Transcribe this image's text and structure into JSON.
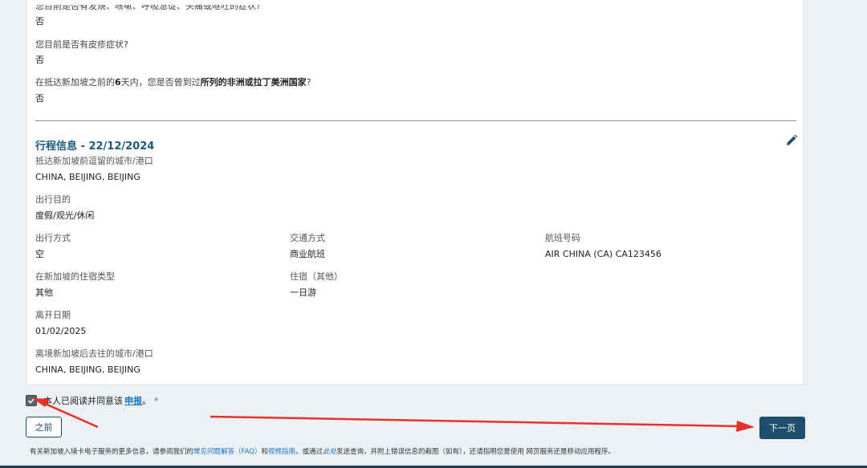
{
  "health": {
    "q1": "您目前是否有发烧、咳嗽、呼吸急促、头痛或呕吐的症状?",
    "a1": "否",
    "q2": "您目前是否有皮疹症状?",
    "a2": "否",
    "q3_pre": "在抵达新加坡之前的",
    "q3_days": "6",
    "q3_mid": "天内，您是否曾到过",
    "q3_bold": "所列的非洲或拉丁美洲国家",
    "q3_post": "?",
    "a3": "否"
  },
  "trip": {
    "title": "行程信息 - 22/12/2024",
    "last_city_label": "抵达新加坡前逗留的城市/港口",
    "last_city_value": "CHINA, BEIJING, BEIJING",
    "purpose_label": "出行目的",
    "purpose_value": "度假/观光/休闲",
    "mode_label": "出行方式",
    "mode_value": "空",
    "transport_label": "交通方式",
    "transport_value": "商业航班",
    "flight_label": "航班号码",
    "flight_value": "AIR CHINA (CA) CA123456",
    "accom_type_label": "在新加坡的住宿类型",
    "accom_type_value": "其他",
    "accom_other_label": "住宿（其他）",
    "accom_other_value": "一日游",
    "depart_date_label": "离开日期",
    "depart_date_value": "01/02/2025",
    "next_city_label": "离境新加坡后去往的城市/港口",
    "next_city_value": "CHINA, BEIJING, BEIJING"
  },
  "agree": {
    "text": "本人已阅读并同意该",
    "link": "申报",
    "period": "。",
    "asterisk": "*"
  },
  "buttons": {
    "prev": "之前",
    "next": "下一页"
  },
  "footer": {
    "t1": "有关新加坡入境卡电子服务的更多信息，请参阅我们的",
    "faq": "常见问题解答（FAQ）",
    "t2": "和",
    "guide": "视频指南",
    "t3": "。或通过",
    "here": "此处",
    "t4": "发送查询，并附上错误信息的截图（如有），还请指明您是使用 网页服务还是移动应用程序。"
  },
  "colors": {
    "accent": "#1d4e6b",
    "title": "#1d5a80",
    "link": "#1a73c8",
    "annotation": "#e8312a"
  }
}
